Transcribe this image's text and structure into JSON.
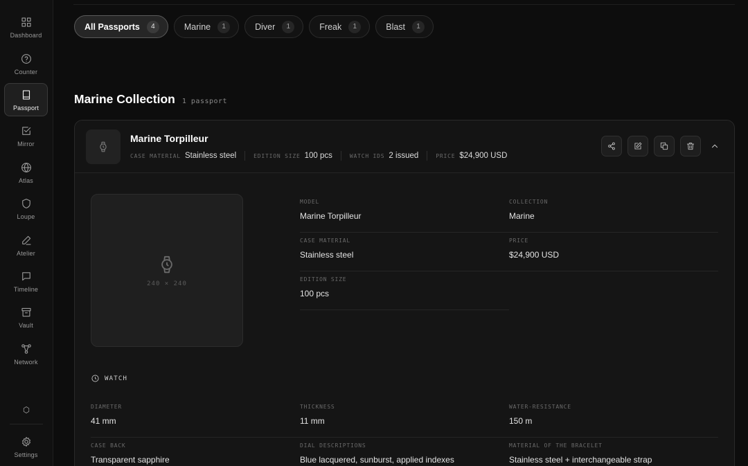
{
  "sidebar": {
    "items": [
      {
        "label": "Dashboard",
        "icon": "grid-icon"
      },
      {
        "label": "Counter",
        "icon": "help-circle-icon"
      },
      {
        "label": "Passport",
        "icon": "book-icon",
        "active": true
      },
      {
        "label": "Mirror",
        "icon": "checkbox-icon"
      },
      {
        "label": "Atlas",
        "icon": "globe-icon"
      },
      {
        "label": "Loupe",
        "icon": "shield-icon"
      },
      {
        "label": "Atelier",
        "icon": "pen-icon"
      },
      {
        "label": "Timeline",
        "icon": "message-square-icon"
      },
      {
        "label": "Vault",
        "icon": "archive-icon"
      },
      {
        "label": "Network",
        "icon": "network-icon"
      }
    ],
    "hex_icon": "hexagon-icon",
    "settings_label": "Settings"
  },
  "filters": [
    {
      "label": "All Passports",
      "count": "4",
      "active": true
    },
    {
      "label": "Marine",
      "count": "1"
    },
    {
      "label": "Diver",
      "count": "1"
    },
    {
      "label": "Freak",
      "count": "1"
    },
    {
      "label": "Blast",
      "count": "1"
    }
  ],
  "section": {
    "title": "Marine Collection",
    "subtitle": "1 passport"
  },
  "card": {
    "title": "Marine Torpilleur",
    "meta": [
      {
        "key": "CASE MATERIAL",
        "value": "Stainless steel"
      },
      {
        "key": "EDITION SIZE",
        "value": "100 pcs"
      },
      {
        "key": "WATCH IDS",
        "value": "2 issued"
      },
      {
        "key": "PRICE",
        "value": "$24,900 USD"
      }
    ],
    "image_placeholder": "240 × 240",
    "details": [
      {
        "key": "MODEL",
        "value": "Marine Torpilleur"
      },
      {
        "key": "COLLECTION",
        "value": "Marine"
      },
      {
        "key": "CASE MATERIAL",
        "value": "Stainless steel"
      },
      {
        "key": "PRICE",
        "value": "$24,900 USD"
      },
      {
        "key": "EDITION SIZE",
        "value": "100 pcs"
      }
    ],
    "watch_section_label": "WATCH",
    "watch_specs": [
      {
        "key": "DIAMETER",
        "value": "41 mm"
      },
      {
        "key": "THICKNESS",
        "value": "11 mm"
      },
      {
        "key": "WATER-RESISTANCE",
        "value": "150 m"
      },
      {
        "key": "CASE BACK",
        "value": "Transparent sapphire"
      },
      {
        "key": "DIAL DESCRIPTIONS",
        "value": "Blue lacquered, sunburst, applied indexes"
      },
      {
        "key": "MATERIAL OF THE BRACELET",
        "value": "Stainless steel + interchangeable strap"
      }
    ]
  }
}
